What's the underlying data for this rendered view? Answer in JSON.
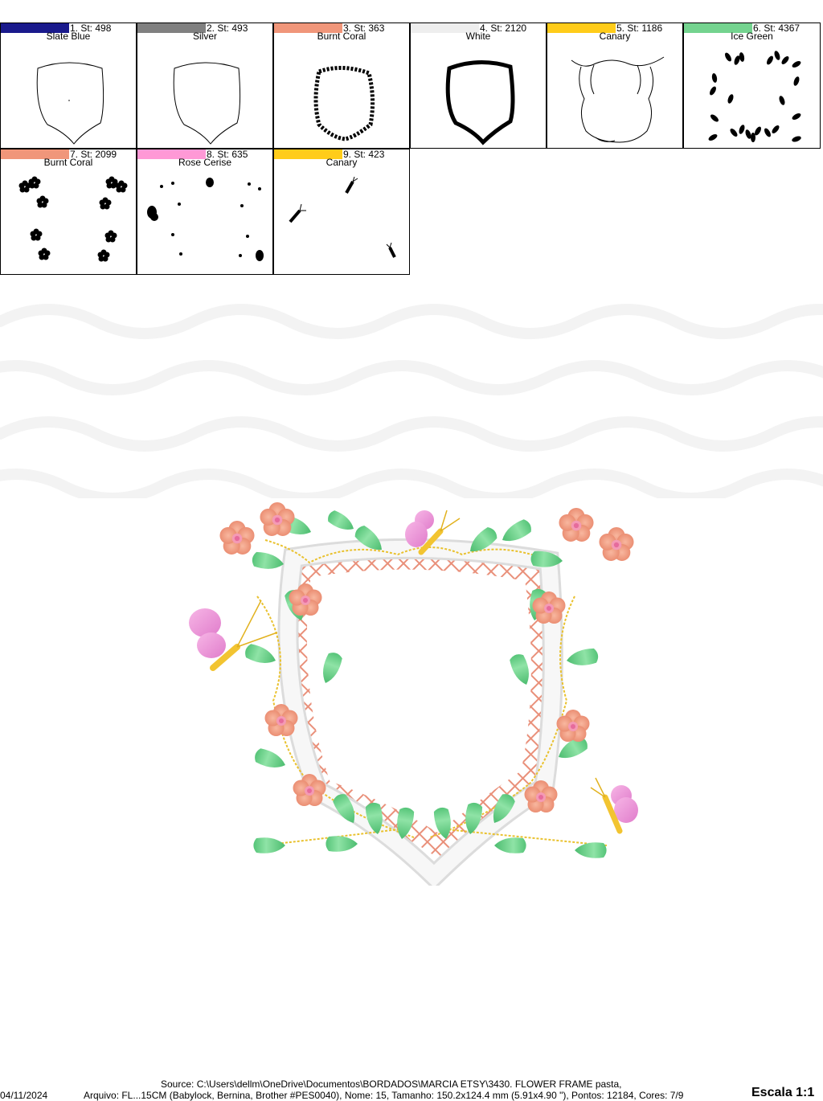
{
  "colors": [
    {
      "label": "1. St: 498",
      "name": "Slate Blue",
      "hex": "#1a1a8c",
      "icon": "shield-outline-thin"
    },
    {
      "label": "2. St: 493",
      "name": "Silver",
      "hex": "#808080",
      "icon": "shield-outline-thin"
    },
    {
      "label": "3. St: 363",
      "name": "Burnt Coral",
      "hex": "#f0967a",
      "icon": "lattice-ring"
    },
    {
      "label": "4. St: 2120",
      "name": "White",
      "hex": "#eeeeee",
      "icon": "shield-outline-bold"
    },
    {
      "label": "5. St: 1186",
      "name": "Canary",
      "hex": "#ffcc1a",
      "icon": "vine-lines"
    },
    {
      "label": "6. St: 4367",
      "name": "Ice Green",
      "hex": "#74d38f",
      "icon": "leaf-petals"
    },
    {
      "label": "7. St: 2099",
      "name": "Burnt Coral",
      "hex": "#f0967a",
      "icon": "flower-clusters"
    },
    {
      "label": "8. St: 635",
      "name": "Rose Cerise",
      "hex": "#ff99d6",
      "icon": "dots-and-wings"
    },
    {
      "label": "9. St: 423",
      "name": "Canary",
      "hex": "#ffcc1a",
      "icon": "butterfly-bodies"
    }
  ],
  "footer": {
    "source": "Source: C:\\Users\\dellm\\OneDrive\\Documentos\\BORDADOS\\MARCIA ETSY\\3430. FLOWER FRAME pasta,",
    "date": "04/11/2024",
    "file": "Arquivo: FL...15CM (Babylock, Bernina, Brother #PES0040), Nome: 15, Tamanho: 150.2x124.4 mm (5.91x4.90 \"), Pontos: 12184, Cores: 7/9",
    "scale": "Escala 1:1"
  },
  "palette": {
    "coral": "#f4a58a",
    "coral_dark": "#e0765e",
    "pink": "#f3a6dd",
    "green": "#7ddc96",
    "green_dark": "#3fae62",
    "yellow": "#f4cf3a",
    "frame_white": "#f3f3f3"
  }
}
